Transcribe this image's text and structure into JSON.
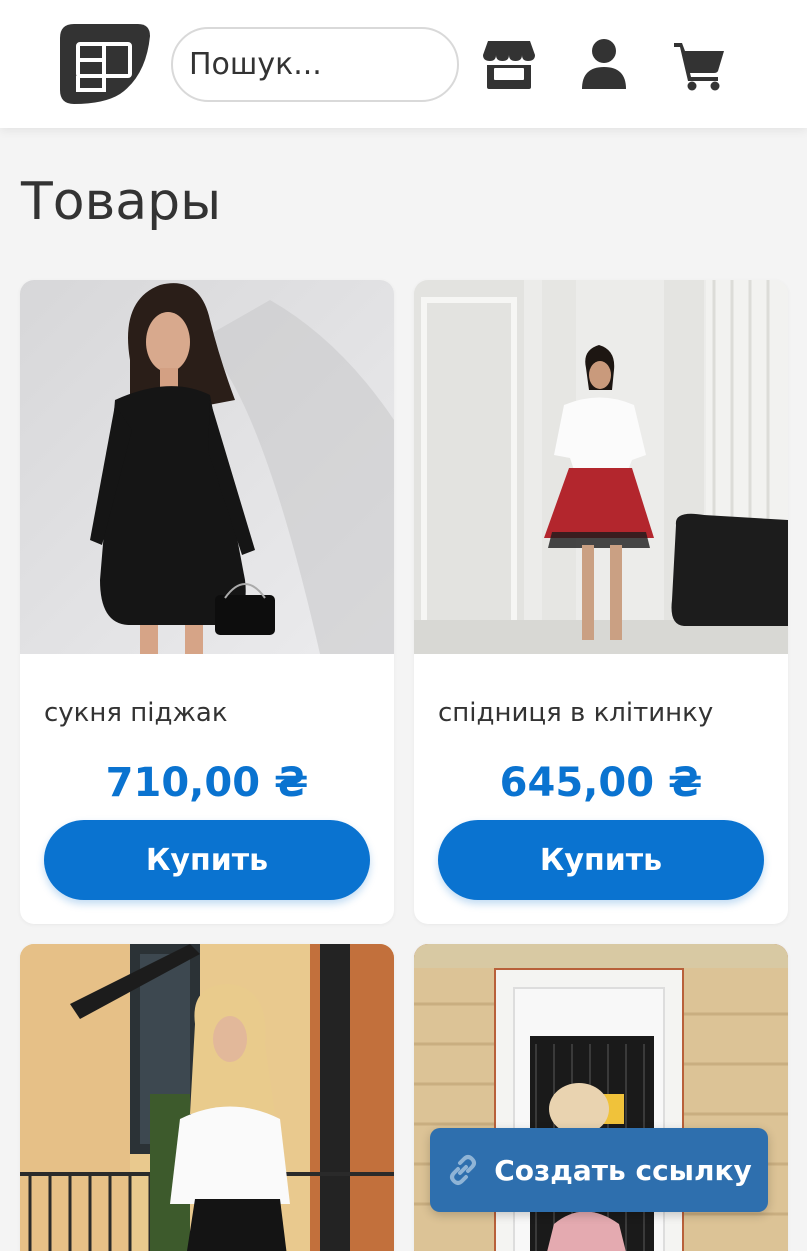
{
  "header": {
    "logo_icon": "store-logo-icon",
    "search": {
      "placeholder": "Пошук...",
      "value": ""
    },
    "icons": [
      "storefront-icon",
      "user-icon",
      "cart-icon"
    ]
  },
  "main": {
    "title": "Товары",
    "products": [
      {
        "name": "сукня піджак",
        "price": "710,00 ₴",
        "buy_label": "Купить"
      },
      {
        "name": "спідниця в клітинку",
        "price": "645,00 ₴",
        "buy_label": "Купить"
      },
      {
        "name": "",
        "price": "",
        "buy_label": ""
      },
      {
        "name": "",
        "price": "",
        "buy_label": ""
      }
    ]
  },
  "share_button": {
    "label": "Создать ссылку",
    "icon": "link-icon"
  },
  "colors": {
    "accent": "#0a73d0",
    "share": "#2e6fae",
    "icon": "#333333",
    "background": "#f4f4f4"
  }
}
